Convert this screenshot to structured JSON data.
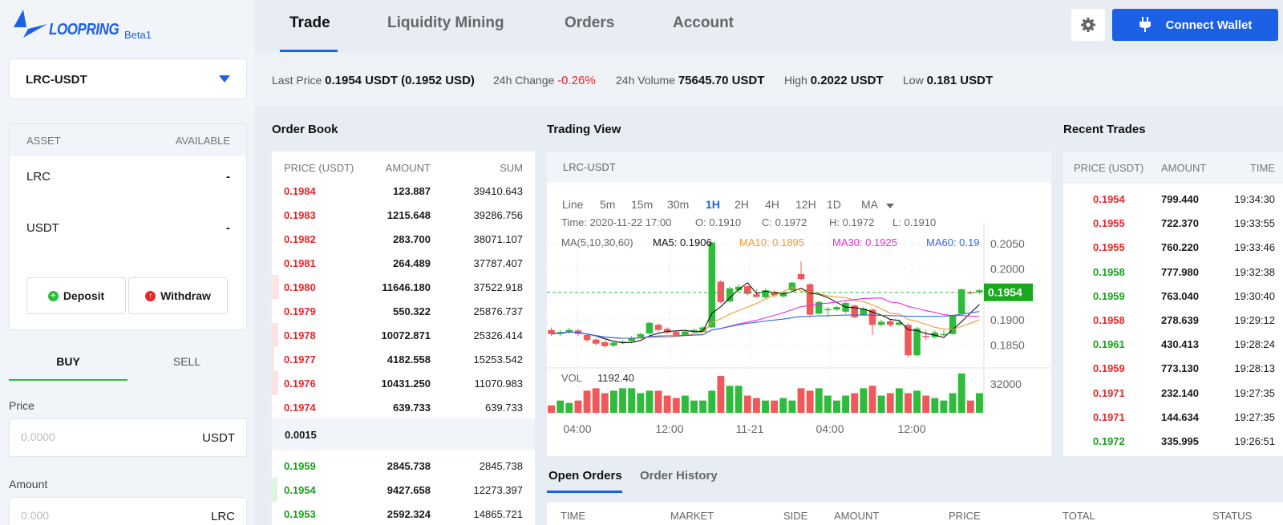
{
  "app": {
    "logo_text": "LOOPRING",
    "beta_label": "Beta1"
  },
  "nav": {
    "tabs": [
      "Trade",
      "Liquidity Mining",
      "Orders",
      "Account"
    ],
    "connect_label": "Connect Wallet"
  },
  "market": {
    "selected": "LRC-USDT"
  },
  "ticker": {
    "last_price_label": "Last Price",
    "last_price": "0.1954 USDT (0.1952 USD)",
    "change_label": "24h Change",
    "change": "-0.26%",
    "volume_label": "24h Volume",
    "volume": "75645.70 USDT",
    "high_label": "High",
    "high": "0.2022 USDT",
    "low_label": "Low",
    "low": "0.181 USDT"
  },
  "assets": {
    "header_asset": "ASSET",
    "header_available": "AVAILABLE",
    "rows": [
      {
        "name": "LRC",
        "available": "-"
      },
      {
        "name": "USDT",
        "available": "-"
      }
    ],
    "deposit_label": "Deposit",
    "withdraw_label": "Withdraw"
  },
  "trade_form": {
    "buy_label": "BUY",
    "sell_label": "SELL",
    "price_label": "Price",
    "price_placeholder": "0.0000",
    "price_unit": "USDT",
    "amount_label": "Amount",
    "amount_placeholder": "0.000",
    "amount_unit": "LRC"
  },
  "order_book": {
    "title": "Order Book",
    "headers": [
      "PRICE (USDT)",
      "AMOUNT",
      "SUM"
    ],
    "asks": [
      {
        "price": "0.1984",
        "amount": "123.887",
        "sum": "39410.643",
        "depth": 0
      },
      {
        "price": "0.1983",
        "amount": "1215.648",
        "sum": "39286.756",
        "depth": 0
      },
      {
        "price": "0.1982",
        "amount": "283.700",
        "sum": "38071.107",
        "depth": 0
      },
      {
        "price": "0.1981",
        "amount": "264.489",
        "sum": "37787.407",
        "depth": 0
      },
      {
        "price": "0.1980",
        "amount": "11646.180",
        "sum": "37522.918",
        "depth": 0.026
      },
      {
        "price": "0.1979",
        "amount": "550.322",
        "sum": "25876.737",
        "depth": 0
      },
      {
        "price": "0.1978",
        "amount": "10072.871",
        "sum": "25326.414",
        "depth": 0.023
      },
      {
        "price": "0.1977",
        "amount": "4182.558",
        "sum": "15253.542",
        "depth": 0.009
      },
      {
        "price": "0.1976",
        "amount": "10431.250",
        "sum": "11070.983",
        "depth": 0.024
      },
      {
        "price": "0.1974",
        "amount": "639.733",
        "sum": "639.733",
        "depth": 0
      }
    ],
    "spread": "0.0015",
    "bids": [
      {
        "price": "0.1959",
        "amount": "2845.738",
        "sum": "2845.738",
        "depth": 0
      },
      {
        "price": "0.1954",
        "amount": "9427.658",
        "sum": "12273.397",
        "depth": 0.02
      },
      {
        "price": "0.1953",
        "amount": "2592.324",
        "sum": "14865.721",
        "depth": 0
      }
    ]
  },
  "trading_view": {
    "title": "Trading View",
    "pair": "LRC-USDT",
    "intervals": [
      "Line",
      "5m",
      "15m",
      "30m",
      "1H",
      "2H",
      "4H",
      "12H",
      "1D",
      "MA"
    ],
    "active_interval": "1H",
    "ohlc": {
      "time_label": "Time:",
      "time": "2020-11-22 17:00",
      "o": "O: 0.1910",
      "c": "C: 0.1972",
      "h": "H: 0.1972",
      "l": "L: 0.1910"
    },
    "ma_label": "MA(5,10,30,60)",
    "ma5": "MA5: 0.1906",
    "ma10": "MA10: 0.1895",
    "ma30": "MA30: 0.1925",
    "ma60": "MA60: 0.19",
    "price_ticks": [
      "0.2050",
      "0.2000",
      "0.1900",
      "0.1850"
    ],
    "current_price": "0.1954",
    "vol_label": "VOL",
    "vol_value": "1192.40",
    "vol_tick": "32000",
    "x_ticks": [
      "04:00",
      "12:00",
      "11-21",
      "04:00",
      "12:00"
    ],
    "colors": {
      "up": "#2fbb3b",
      "down": "#f0585a",
      "ma5": "#111111",
      "ma10": "#f29a2e",
      "ma30": "#e02ee0",
      "ma60": "#2e6ae0"
    }
  },
  "chart_data": {
    "type": "candlestick",
    "y_range": [
      0.181,
      0.2075
    ],
    "candles": [
      [
        0.188,
        0.1872,
        0.1885,
        0.1868
      ],
      [
        0.1872,
        0.1876,
        0.188,
        0.1868
      ],
      [
        0.1876,
        0.188,
        0.1884,
        0.1872
      ],
      [
        0.1879,
        0.1872,
        0.1882,
        0.1868
      ],
      [
        0.187,
        0.186,
        0.1873,
        0.1856
      ],
      [
        0.1861,
        0.1853,
        0.1864,
        0.185
      ],
      [
        0.1856,
        0.1848,
        0.186,
        0.1845
      ],
      [
        0.1849,
        0.1855,
        0.1858,
        0.1846
      ],
      [
        0.1855,
        0.1857,
        0.186,
        0.1852
      ],
      [
        0.1858,
        0.1864,
        0.1868,
        0.1854
      ],
      [
        0.1866,
        0.1872,
        0.1875,
        0.1862
      ],
      [
        0.1873,
        0.1894,
        0.1896,
        0.1871
      ],
      [
        0.189,
        0.188,
        0.1893,
        0.1876
      ],
      [
        0.1882,
        0.1875,
        0.1885,
        0.1872
      ],
      [
        0.1876,
        0.187,
        0.1878,
        0.1866
      ],
      [
        0.187,
        0.1877,
        0.188,
        0.1868
      ],
      [
        0.1876,
        0.188,
        0.1883,
        0.1874
      ],
      [
        0.1876,
        0.1885,
        0.1888,
        0.1875
      ],
      [
        0.1885,
        0.2052,
        0.2054,
        0.1884
      ],
      [
        0.1975,
        0.1935,
        0.1978,
        0.1932
      ],
      [
        0.1936,
        0.1962,
        0.1965,
        0.1934
      ],
      [
        0.1958,
        0.1965,
        0.197,
        0.1955
      ],
      [
        0.1966,
        0.1951,
        0.1968,
        0.1948
      ],
      [
        0.195,
        0.1945,
        0.196,
        0.1944
      ],
      [
        0.1944,
        0.1958,
        0.1962,
        0.1942
      ],
      [
        0.1955,
        0.1948,
        0.1958,
        0.1944
      ],
      [
        0.1946,
        0.1952,
        0.1955,
        0.1943
      ],
      [
        0.1958,
        0.1973,
        0.1975,
        0.1955
      ],
      [
        0.199,
        0.198,
        0.2015,
        0.1978
      ],
      [
        0.197,
        0.191,
        0.1972,
        0.1905
      ],
      [
        0.1912,
        0.1935,
        0.1938,
        0.191
      ],
      [
        0.192,
        0.1921,
        0.1925,
        0.1905
      ],
      [
        0.192,
        0.1925,
        0.1928,
        0.1917
      ],
      [
        0.1916,
        0.1933,
        0.1936,
        0.1913
      ],
      [
        0.1928,
        0.1905,
        0.193,
        0.1903
      ],
      [
        0.191,
        0.1922,
        0.1925,
        0.1908
      ],
      [
        0.192,
        0.189,
        0.1922,
        0.187
      ],
      [
        0.189,
        0.1896,
        0.19,
        0.1887
      ],
      [
        0.1897,
        0.189,
        0.19,
        0.1886
      ],
      [
        0.189,
        0.1895,
        0.19,
        0.1888
      ],
      [
        0.189,
        0.183,
        0.1893,
        0.1826
      ],
      [
        0.183,
        0.1883,
        0.1886,
        0.1828
      ],
      [
        0.1868,
        0.1866,
        0.188,
        0.186
      ],
      [
        0.1866,
        0.1875,
        0.1879,
        0.1863
      ],
      [
        0.187,
        0.1872,
        0.188,
        0.1868
      ],
      [
        0.1872,
        0.1908,
        0.191,
        0.187
      ],
      [
        0.1912,
        0.196,
        0.1962,
        0.191
      ],
      [
        0.1954,
        0.1952,
        0.1957,
        0.195
      ],
      [
        0.1954,
        0.1958,
        0.196,
        0.1951
      ]
    ],
    "volumes": [
      3,
      5,
      4,
      5,
      9,
      10,
      8,
      9,
      10,
      10,
      8,
      9,
      9,
      7,
      6,
      7,
      5,
      5,
      9,
      15,
      11,
      11,
      7,
      6,
      5,
      5,
      6,
      5,
      10,
      9,
      10,
      7,
      5,
      7,
      8,
      10,
      11,
      7,
      8,
      10,
      8,
      9,
      7,
      6,
      5,
      8,
      16,
      5,
      8
    ]
  },
  "recent_trades": {
    "title": "Recent Trades",
    "headers": [
      "PRICE (USDT)",
      "AMOUNT",
      "TIME"
    ],
    "rows": [
      {
        "price": "0.1954",
        "amount": "799.440",
        "time": "19:34:30",
        "side": "sell"
      },
      {
        "price": "0.1955",
        "amount": "722.370",
        "time": "19:33:55",
        "side": "sell"
      },
      {
        "price": "0.1955",
        "amount": "760.220",
        "time": "19:33:46",
        "side": "sell"
      },
      {
        "price": "0.1958",
        "amount": "777.980",
        "time": "19:32:38",
        "side": "buy"
      },
      {
        "price": "0.1959",
        "amount": "763.040",
        "time": "19:30:40",
        "side": "buy"
      },
      {
        "price": "0.1958",
        "amount": "278.639",
        "time": "19:29:12",
        "side": "sell"
      },
      {
        "price": "0.1961",
        "amount": "430.413",
        "time": "19:28:24",
        "side": "buy"
      },
      {
        "price": "0.1959",
        "amount": "773.130",
        "time": "19:28:13",
        "side": "sell"
      },
      {
        "price": "0.1971",
        "amount": "232.140",
        "time": "19:27:35",
        "side": "sell"
      },
      {
        "price": "0.1971",
        "amount": "144.634",
        "time": "19:27:35",
        "side": "sell"
      },
      {
        "price": "0.1972",
        "amount": "335.995",
        "time": "19:26:51",
        "side": "buy"
      }
    ]
  },
  "orders": {
    "tabs": [
      "Open Orders",
      "Order History"
    ],
    "headers": [
      "TIME",
      "MARKET",
      "SIDE",
      "AMOUNT",
      "PRICE",
      "TOTAL",
      "STATUS"
    ]
  }
}
